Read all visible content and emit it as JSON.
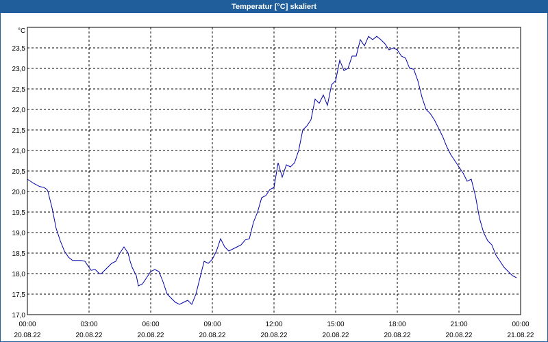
{
  "window": {
    "title": "Temperatur [°C] skaliert"
  },
  "chart_data": {
    "type": "line",
    "title": "Temperatur [°C] skaliert",
    "ylabel": "°C",
    "xlabel": "",
    "ylim": [
      17.0,
      24.0
    ],
    "xlim_hours": [
      0,
      24
    ],
    "grid": true,
    "line_color": "#0000aa",
    "y_ticks": [
      "17,0",
      "17,5",
      "18,0",
      "18,5",
      "19,0",
      "19,5",
      "20,0",
      "20,5",
      "21,0",
      "21,5",
      "22,0",
      "22,5",
      "23,0",
      "23,5"
    ],
    "x_ticks": [
      {
        "time": "00:00",
        "date": "20.08.22"
      },
      {
        "time": "03:00",
        "date": "20.08.22"
      },
      {
        "time": "06:00",
        "date": "20.08.22"
      },
      {
        "time": "09:00",
        "date": "20.08.22"
      },
      {
        "time": "12:00",
        "date": "20.08.22"
      },
      {
        "time": "15:00",
        "date": "20.08.22"
      },
      {
        "time": "18:00",
        "date": "20.08.22"
      },
      {
        "time": "21:00",
        "date": "20.08.22"
      },
      {
        "time": "00:00",
        "date": "21.08.22"
      }
    ],
    "series": [
      {
        "x_hours": [
          0.0,
          0.3,
          0.6,
          0.8,
          0.95,
          1.0,
          1.2,
          1.4,
          1.6,
          1.8,
          2.0,
          2.2,
          2.4,
          2.6,
          2.8,
          3.0,
          3.1,
          3.3,
          3.5,
          3.6,
          3.9,
          4.1,
          4.3,
          4.5,
          4.7,
          4.9,
          5.0,
          5.1,
          5.3,
          5.4,
          5.6,
          5.8,
          6.0,
          6.2,
          6.4,
          6.6,
          6.8,
          7.0,
          7.2,
          7.4,
          7.6,
          7.8,
          8.0,
          8.2,
          8.4,
          8.6,
          8.8,
          9.0,
          9.2,
          9.4,
          9.6,
          9.8,
          10.0,
          10.2,
          10.4,
          10.6,
          10.8,
          11.0,
          11.2,
          11.4,
          11.6,
          11.8,
          12.0,
          12.2,
          12.4,
          12.6,
          12.8,
          13.0,
          13.2,
          13.4,
          13.6,
          13.8,
          14.0,
          14.2,
          14.4,
          14.6,
          14.8,
          15.0,
          15.2,
          15.4,
          15.6,
          15.8,
          16.0,
          16.2,
          16.4,
          16.6,
          16.8,
          17.0,
          17.2,
          17.4,
          17.6,
          17.8,
          18.0,
          18.2,
          18.4,
          18.6,
          18.8,
          19.0,
          19.2,
          19.4,
          19.6,
          19.8,
          20.0,
          20.2,
          20.4,
          20.6,
          20.8,
          21.0,
          21.2,
          21.4,
          21.6,
          21.8,
          22.0,
          22.2,
          22.4,
          22.6,
          22.8,
          23.0,
          23.2,
          23.4,
          23.6,
          23.8,
          24.0
        ],
        "values": [
          20.3,
          20.2,
          20.12,
          20.1,
          20.05,
          20.0,
          19.6,
          19.1,
          18.8,
          18.55,
          18.4,
          18.32,
          18.32,
          18.32,
          18.3,
          18.15,
          18.08,
          18.1,
          18.0,
          18.0,
          18.15,
          18.25,
          18.3,
          18.5,
          18.65,
          18.5,
          18.3,
          18.15,
          17.95,
          17.7,
          17.75,
          17.9,
          18.05,
          18.1,
          18.05,
          17.8,
          17.5,
          17.4,
          17.3,
          17.25,
          17.3,
          17.35,
          17.25,
          17.5,
          17.9,
          18.3,
          18.25,
          18.35,
          18.55,
          18.85,
          18.65,
          18.55,
          18.6,
          18.65,
          18.7,
          18.82,
          18.85,
          19.25,
          19.5,
          19.85,
          19.9,
          20.05,
          20.1,
          20.7,
          20.35,
          20.65,
          20.6,
          20.7,
          21.0,
          21.5,
          21.6,
          21.75,
          22.25,
          22.15,
          22.35,
          22.1,
          22.6,
          22.7,
          23.2,
          22.95,
          23.0,
          23.3,
          23.3,
          23.7,
          23.55,
          23.78,
          23.7,
          23.78,
          23.7,
          23.6,
          23.45,
          23.5,
          23.45,
          23.3,
          23.25,
          23.0,
          22.98,
          22.7,
          22.3,
          22.0,
          21.9,
          21.75,
          21.55,
          21.35,
          21.1,
          20.9,
          20.75,
          20.6,
          20.45,
          20.25,
          20.3,
          19.9,
          19.35,
          19.0,
          18.8,
          18.7,
          18.45,
          18.3,
          18.15,
          18.05,
          17.95,
          17.9
        ]
      }
    ]
  }
}
